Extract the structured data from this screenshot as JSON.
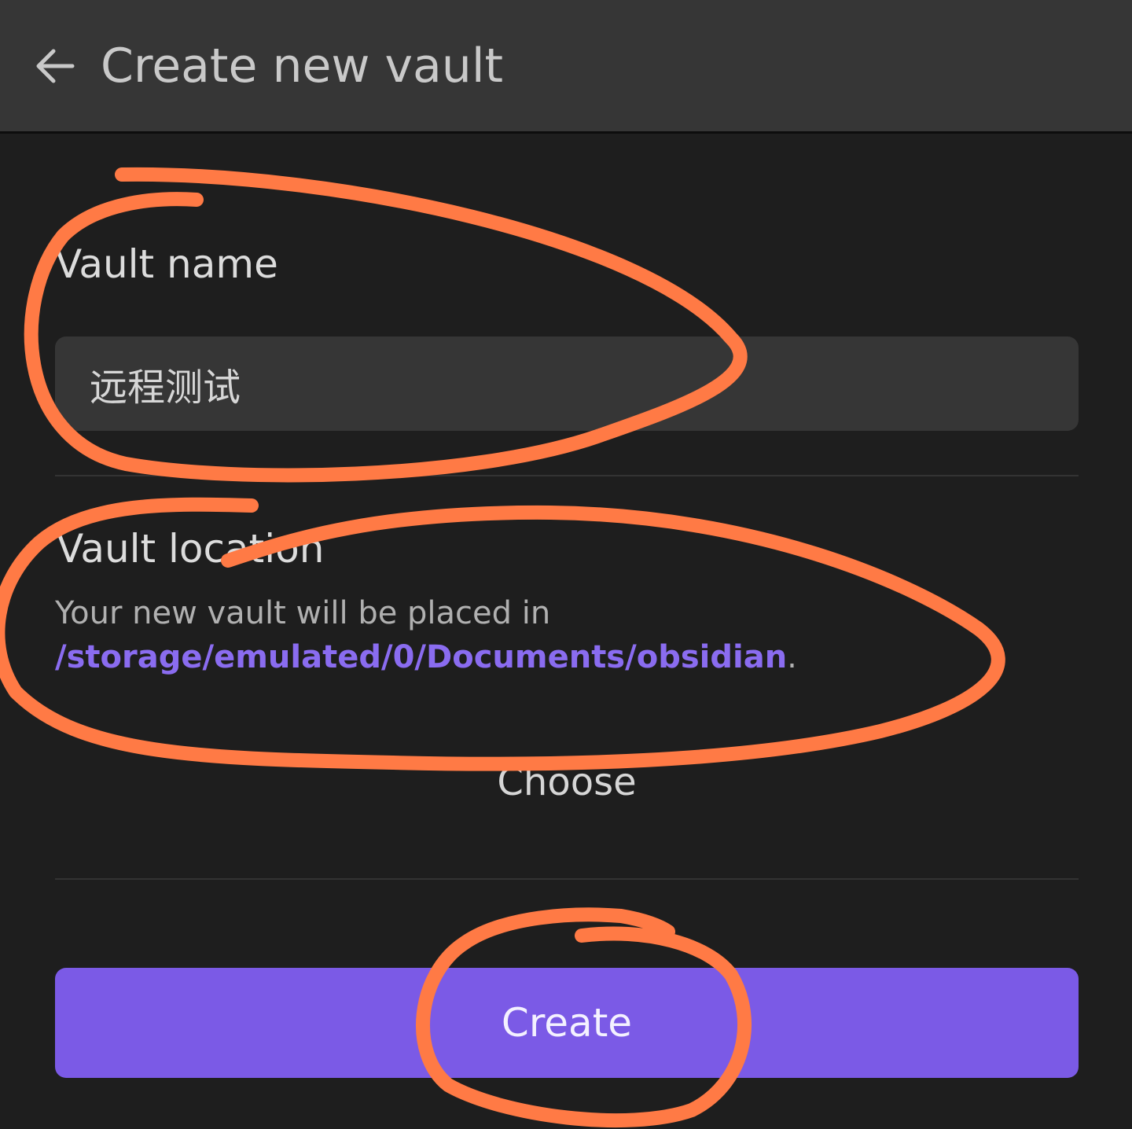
{
  "header": {
    "back_icon": "arrow-left-icon",
    "title": "Create new vault"
  },
  "vault_name": {
    "label": "Vault name",
    "value": "远程测试"
  },
  "vault_location": {
    "label": "Vault location",
    "description_prefix": "Your new vault will be placed in",
    "path": "/storage/emulated/0/Documents/obsidian",
    "description_suffix": ".",
    "choose_label": "Choose"
  },
  "create_label": "Create",
  "colors": {
    "background": "#1e1e1e",
    "header": "#363636",
    "accent": "#7b5ae6",
    "path_link": "#8a6cf0",
    "annotation": "#ff7a45"
  }
}
